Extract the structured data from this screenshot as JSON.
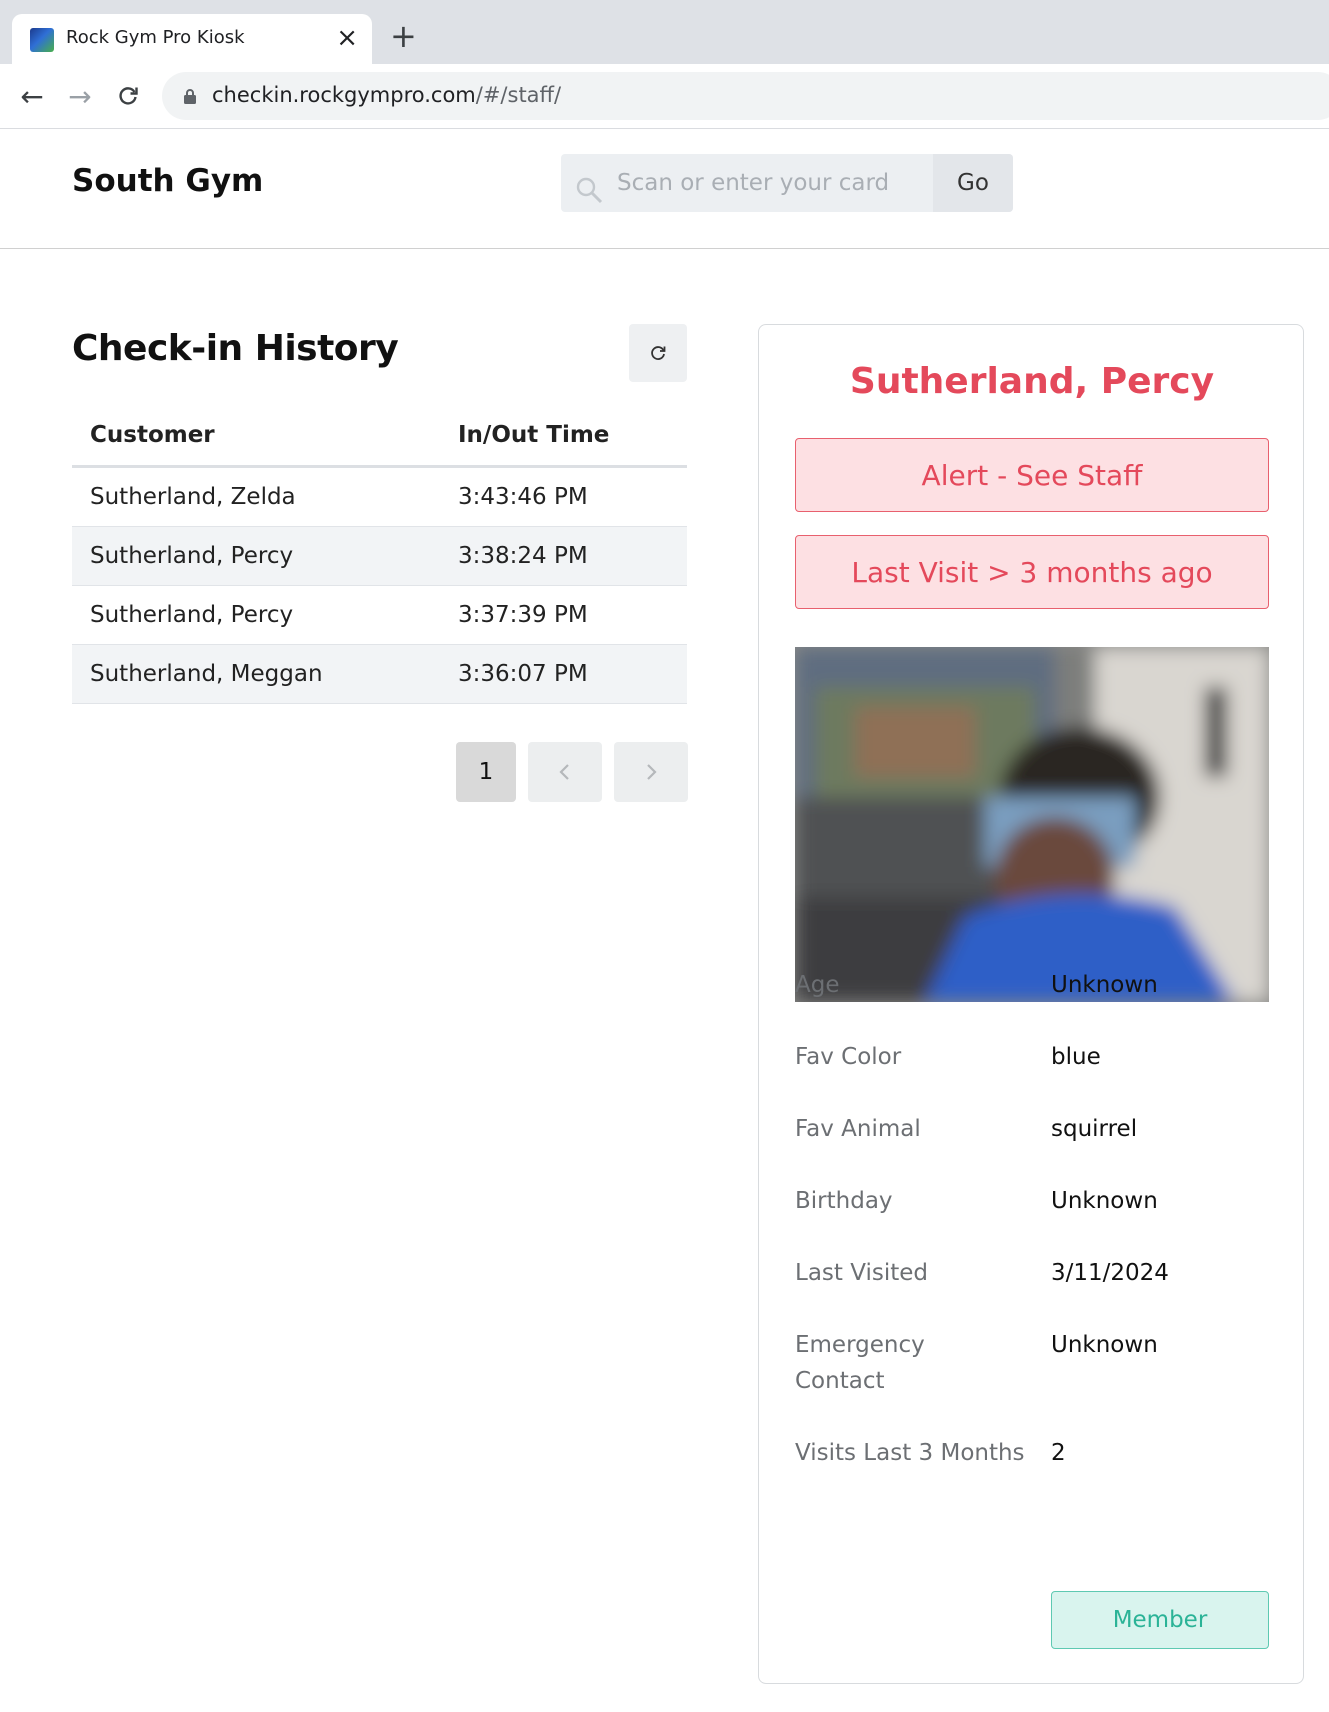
{
  "browser": {
    "tab_title": "Rock Gym Pro Kiosk",
    "url_host": "checkin.rockgympro.com",
    "url_path": "/#/staff/"
  },
  "header": {
    "gym_name": "South Gym",
    "search_placeholder": "Scan or enter your card",
    "go_label": "Go"
  },
  "history": {
    "title": "Check-in History",
    "columns": [
      "Customer",
      "In/Out Time"
    ],
    "rows": [
      {
        "customer": "Sutherland, Zelda",
        "time": "3:43:46 PM"
      },
      {
        "customer": "Sutherland, Percy",
        "time": "3:38:24 PM"
      },
      {
        "customer": "Sutherland, Percy",
        "time": "3:37:39 PM"
      },
      {
        "customer": "Sutherland, Meggan",
        "time": "3:36:07 PM"
      }
    ],
    "current_page": "1"
  },
  "customer": {
    "name": "Sutherland, Percy",
    "alerts": [
      "Alert - See Staff",
      "Last Visit > 3 months ago"
    ],
    "details": [
      {
        "label": "Age",
        "value": "Unknown"
      },
      {
        "label": "Fav Color",
        "value": "blue"
      },
      {
        "label": "Fav Animal",
        "value": "squirrel"
      },
      {
        "label": "Birthday",
        "value": "Unknown"
      },
      {
        "label": "Last Visited",
        "value": "3/11/2024"
      },
      {
        "label": "Emergency Contact",
        "value": "Unknown"
      },
      {
        "label": "Visits Last 3 Months",
        "value": "2"
      }
    ],
    "member_label": "Member"
  },
  "colors": {
    "accent_red": "#e4495b",
    "alert_bg": "#fde0e3",
    "member_teal": "#2bb397",
    "member_bg": "#d9f4ee"
  }
}
